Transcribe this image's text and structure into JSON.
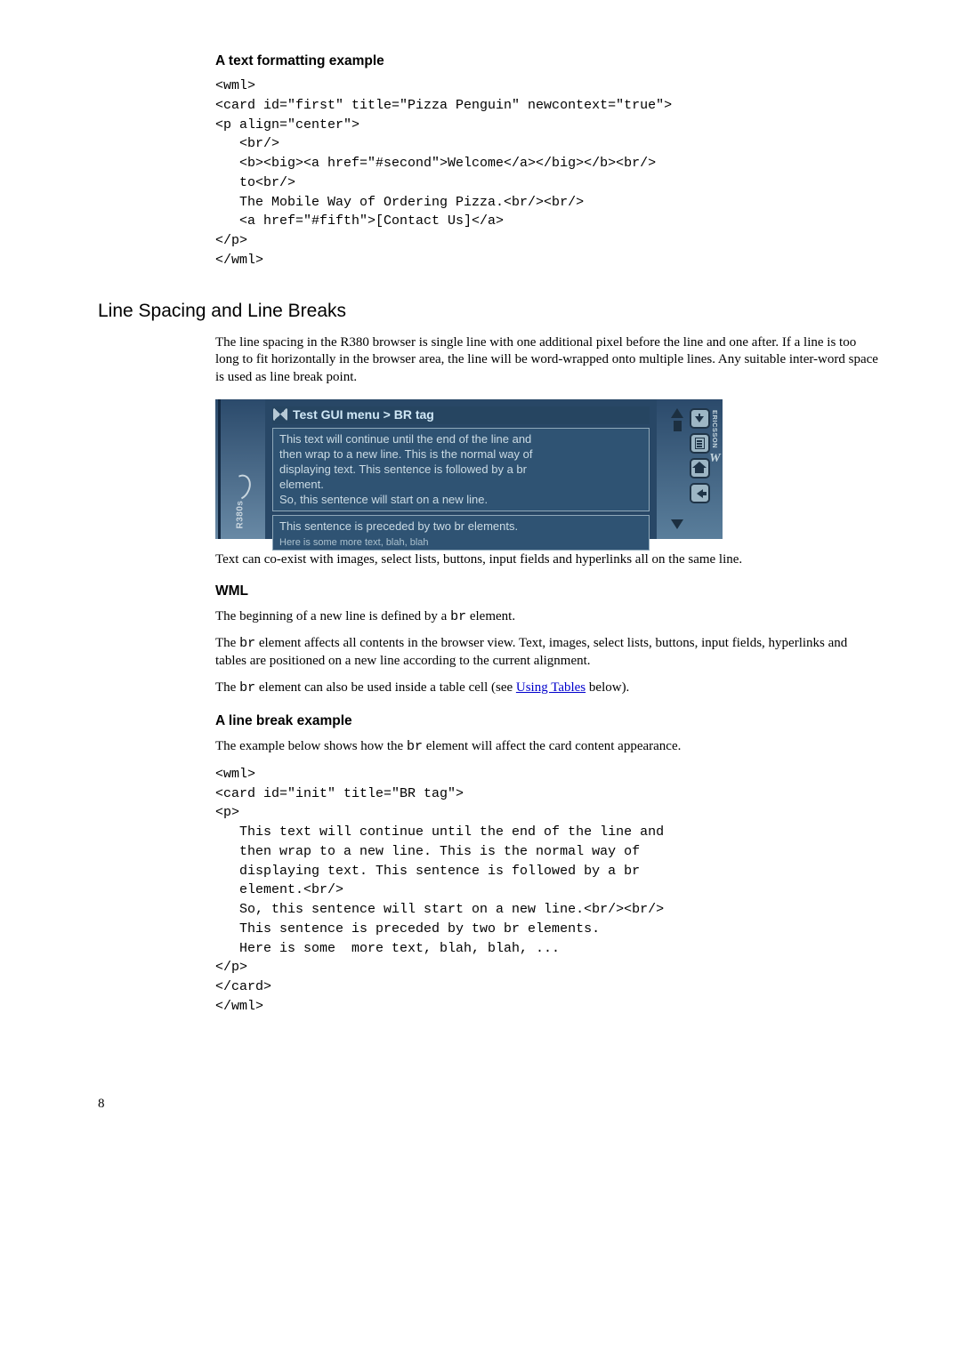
{
  "example1": {
    "heading": "A text formatting example",
    "code": "<wml>\n<card id=\"first\" title=\"Pizza Penguin\" newcontext=\"true\">\n<p align=\"center\">\n   <br/>\n   <b><big><a href=\"#second\">Welcome</a></big></b><br/>\n   to<br/>\n   The Mobile Way of Ordering Pizza.<br/><br/>\n   <a href=\"#fifth\">[Contact Us]</a>\n</p>\n</wml>"
  },
  "section": {
    "heading": "Line Spacing and Line Breaks",
    "p1": "The line spacing in the R380 browser is single line with one additional pixel before the line and one after.  If a line is too long to fit horizontally in the browser area, the line will be word-wrapped onto multiple lines.  Any suitable inter-word space is used as line break point.",
    "p2": "Text can co-exist with images, select lists, buttons, input fields and hyperlinks all on the same line."
  },
  "screenshot": {
    "device": "R380s",
    "brand": "ERICSSON",
    "title": "Test GUI menu > BR tag",
    "box1_l1": "This text will continue until the end of the line and",
    "box1_l2": "then wrap to a new line. This is the normal way of",
    "box1_l3": "displaying text. This sentence is followed by a br",
    "box1_l4": "element.",
    "box1_l5": "So, this sentence will start on a new line.",
    "box2_l1": "This sentence is preceded by two br elements.",
    "box2_l2": "Here is some more text, blah, blah"
  },
  "wml": {
    "heading": "WML",
    "p1a": "The beginning of a new line is defined by a ",
    "p1b": " element.",
    "p2a": "The ",
    "p2b": " element affects all contents in the browser view.  Text, images, select lists, buttons, input fields, hyperlinks and tables are positioned on a new line according to the current alignment.",
    "p3a": "The ",
    "p3b": " element can also be used inside a table cell (see ",
    "p3link": "Using Tables",
    "p3c": " below).",
    "br": "br"
  },
  "example2": {
    "heading": "A line break example",
    "p1a": "The example below shows how the ",
    "p1b": " element will affect the card content appearance.",
    "br": "br",
    "code": "<wml>\n<card id=\"init\" title=\"BR tag\">\n<p>\n   This text will continue until the end of the line and\n   then wrap to a new line. This is the normal way of\n   displaying text. This sentence is followed by a br\n   element.<br/>\n   So, this sentence will start on a new line.<br/><br/>\n   This sentence is preceded by two br elements.\n   Here is some  more text, blah, blah, ...\n</p>\n</card>\n</wml>"
  },
  "page_number": "8"
}
